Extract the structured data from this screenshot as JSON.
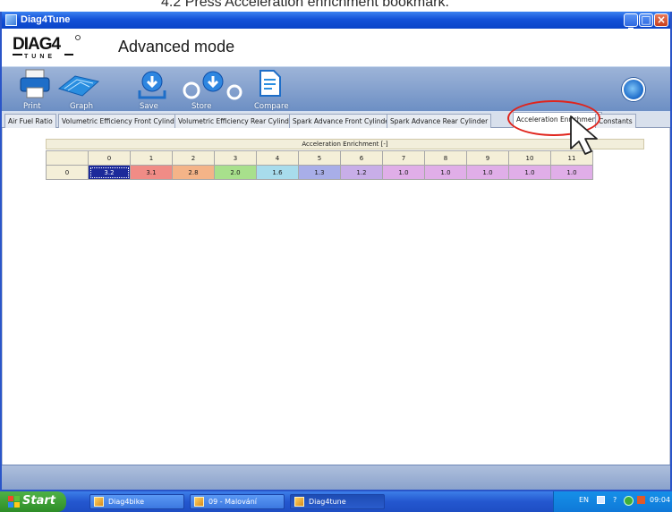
{
  "caption": "4.2 Press Acceleration enrichment bookmark.",
  "window": {
    "title": "Diag4Tune"
  },
  "header": {
    "mode": "Advanced mode",
    "logo_top": "DIAG4",
    "logo_bottom": "TUNE"
  },
  "toolbar": {
    "items": [
      {
        "label": "Print",
        "icon": "printer-icon"
      },
      {
        "label": "Graph",
        "icon": "graph-icon"
      },
      {
        "label": "Save",
        "icon": "save-icon"
      },
      {
        "label": "Store",
        "icon": "store-icon"
      },
      {
        "label": "Compare",
        "icon": "compare-icon"
      }
    ]
  },
  "tabs": [
    "Air Fuel Ratio",
    "Volumetric Efficiency Front Cylinder",
    "Volumetric Efficiency Rear Cylinder",
    "Spark Advance Front Cylinder",
    "Spark Advance Rear Cylinder",
    "Acceleration Enrichment",
    "Constants"
  ],
  "active_tab": "Acceleration Enrichment",
  "grid": {
    "title": "Acceleration Enrichment [-]",
    "columns": [
      "0",
      "1",
      "2",
      "3",
      "4",
      "5",
      "6",
      "7",
      "8",
      "9",
      "10",
      "11"
    ],
    "row_label": "0",
    "values": [
      "3.2",
      "3.1",
      "2.8",
      "2.0",
      "1.6",
      "1.3",
      "1.2",
      "1.0",
      "1.0",
      "1.0",
      "1.0",
      "1.0"
    ],
    "colors": [
      "#1c2a9a",
      "#f08c86",
      "#f4b488",
      "#a8e08c",
      "#a8dcec",
      "#a8aee8",
      "#c8aee8",
      "#e0aee8",
      "#e0aee8",
      "#e0aee8",
      "#e0aee8",
      "#e0aee8"
    ],
    "selected_index": 0
  },
  "taskbar": {
    "start": "Start",
    "tasks": [
      "Diag4bike",
      "09 - Malování",
      "Diag4tune"
    ],
    "lang": "EN",
    "clock": "09:04"
  }
}
